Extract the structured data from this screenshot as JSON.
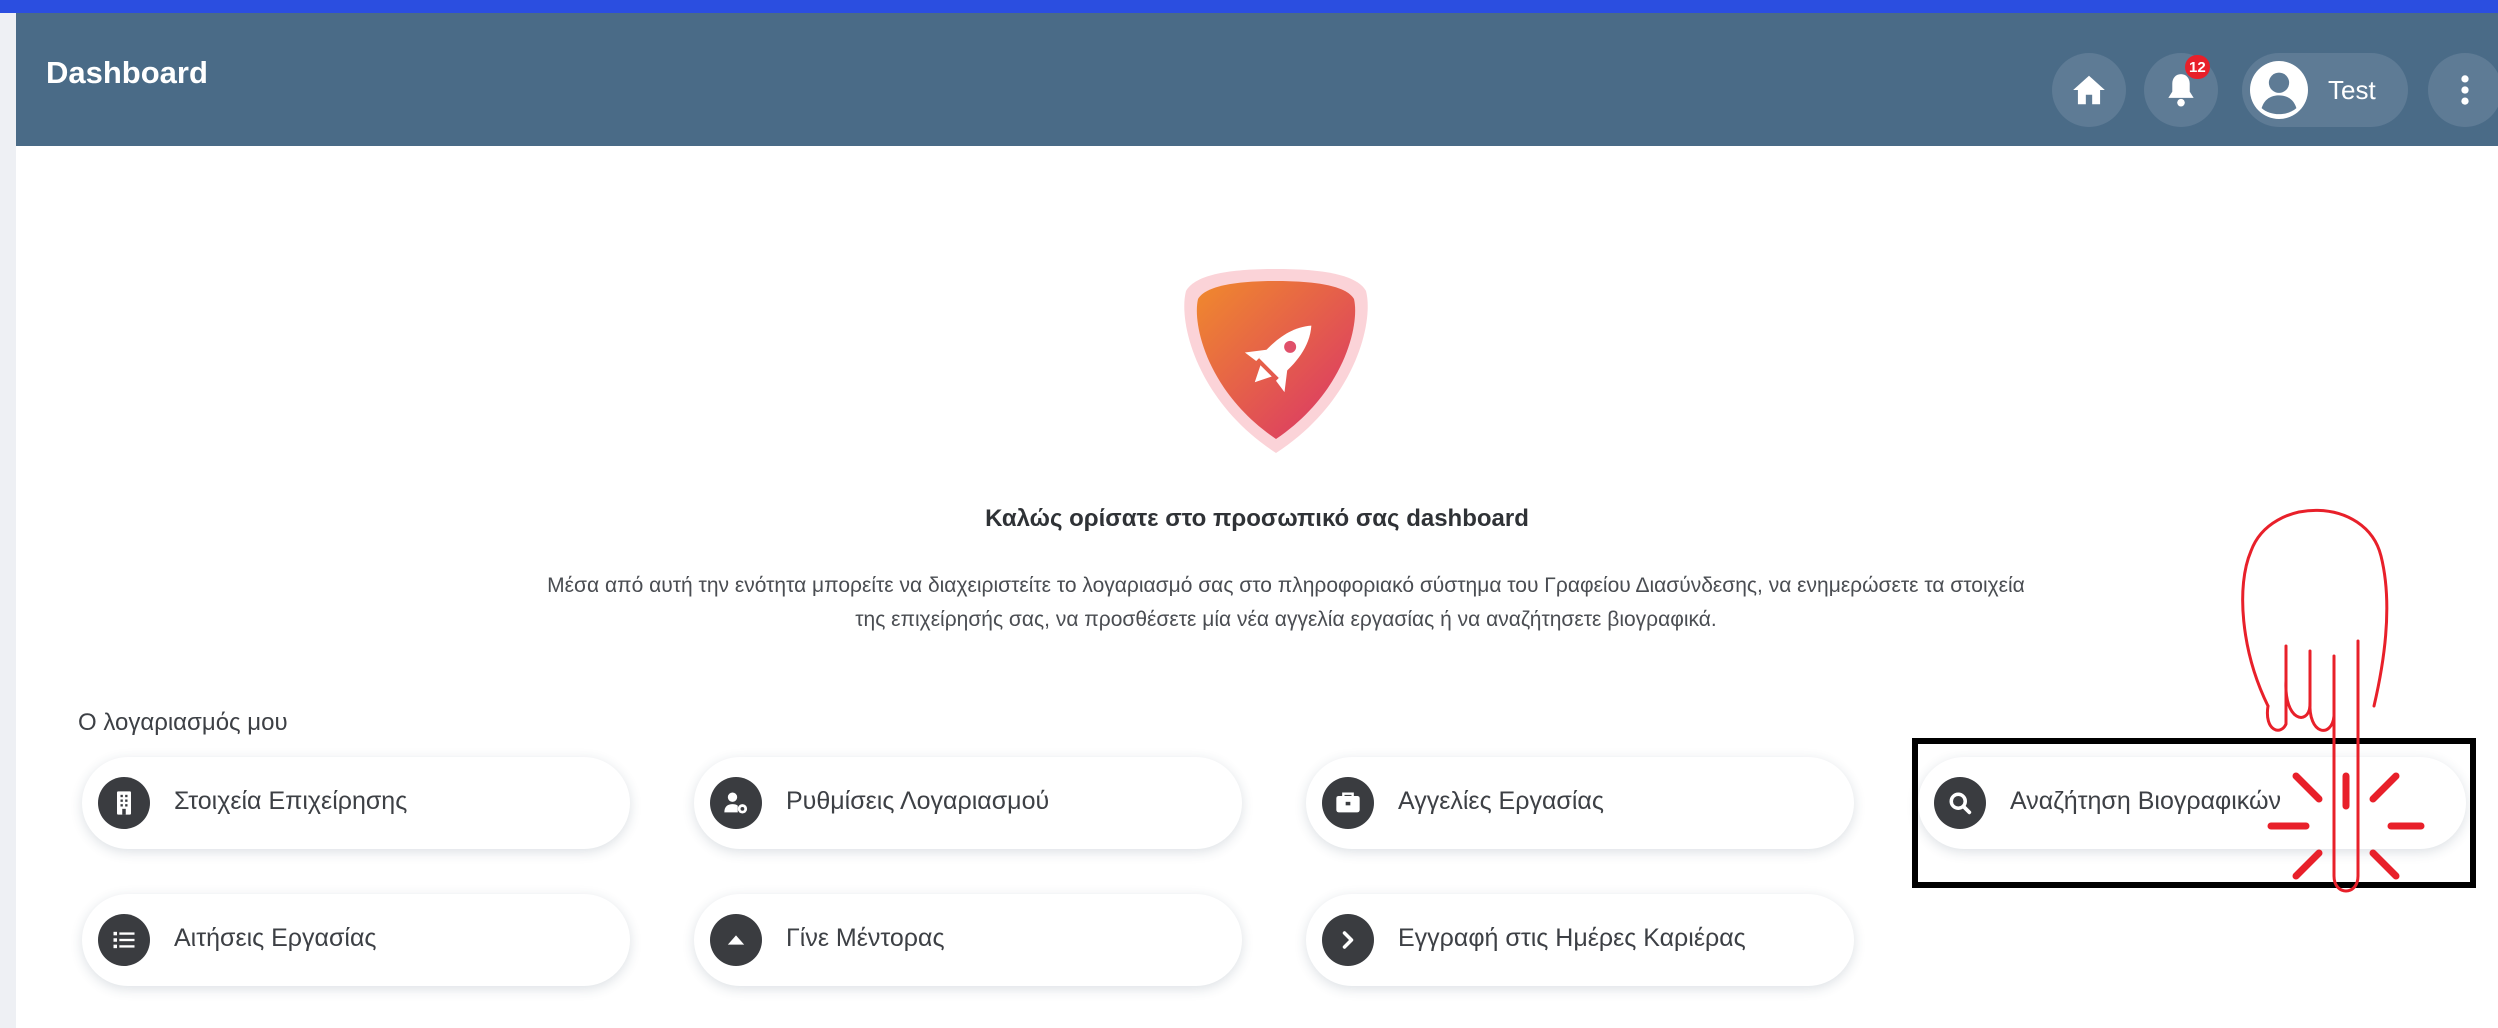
{
  "header": {
    "title": "Dashboard",
    "notification_count": "12",
    "user_name": "Test",
    "color": "#4a6b87"
  },
  "welcome": {
    "title": "Καλώς ορίσατε στο προσωπικό σας dashboard",
    "text": "Μέσα από αυτή την ενότητα μπορείτε να διαχειριστείτε το λογαριασμό σας στο πληροφοριακό σύστημα του Γραφείου Διασύνδεσης, να ενημερώσετε τα στοιχεία της επιχείρησής σας, να προσθέσετε μία νέα αγγελία εργασίας ή να αναζήτησετε βιογραφικά."
  },
  "account": {
    "section_title": "Ο λογαριασμός μου",
    "items": [
      {
        "label": "Στοιχεία Επιχείρησης",
        "icon": "building-icon"
      },
      {
        "label": "Ρυθμίσεις Λογαριασμού",
        "icon": "user-gear-icon"
      },
      {
        "label": "Αγγελίες Εργασίας",
        "icon": "briefcase-icon"
      },
      {
        "label": "Αναζήτηση Βιογραφικών",
        "icon": "search-icon"
      },
      {
        "label": "Αιτήσεις Εργασίας",
        "icon": "list-icon"
      },
      {
        "label": "Γίνε Μέντορας",
        "icon": "caret-up-icon"
      },
      {
        "label": "Εγγραφή στις Ημέρες Καριέρας",
        "icon": "chevron-right-icon"
      }
    ]
  },
  "colors": {
    "accent_bar": "#2b4ee0",
    "logo_gradient_start": "#f08a2c",
    "logo_gradient_end": "#d9316b",
    "annotation": "#e8202a"
  }
}
